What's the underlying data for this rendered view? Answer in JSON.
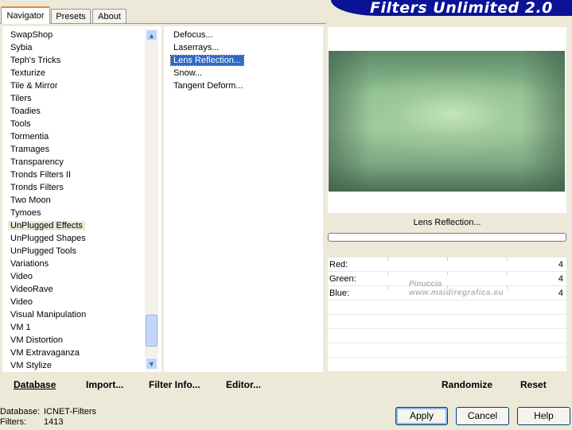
{
  "tabs": [
    {
      "label": "Navigator",
      "active": true
    },
    {
      "label": "Presets",
      "active": false
    },
    {
      "label": "About",
      "active": false
    }
  ],
  "banner": {
    "title": "Filters Unlimited 2.0",
    "color": "#0a1296"
  },
  "categories": [
    "SwapShop",
    "Sybia",
    "Teph's Tricks",
    "Texturize",
    "Tile & Mirror",
    "Tilers",
    "Toadies",
    "Tools",
    "Tormentia",
    "Tramages",
    "Transparency",
    "Tronds Filters II",
    "Tronds Filters",
    "Two Moon",
    "Tymoes",
    "UnPlugged Effects",
    "UnPlugged Shapes",
    "UnPlugged Tools",
    "Variations",
    "Video",
    "VideoRave",
    "Video",
    "Visual Manipulation",
    "VM 1",
    "VM Distortion",
    "VM Extravaganza",
    "VM Stylize"
  ],
  "selected_category": "UnPlugged Effects",
  "filters": [
    "Defocus...",
    "Laserrays...",
    "Lens Reflection...",
    "Snow...",
    "Tangent Deform..."
  ],
  "selected_filter": "Lens Reflection...",
  "toolbar": {
    "database": "Database",
    "import": "Import...",
    "filter_info": "Filter Info...",
    "editor": "Editor...",
    "randomize": "Randomize",
    "reset": "Reset"
  },
  "preview": {
    "filter_name": "Lens Reflection..."
  },
  "params": [
    {
      "label": "Red:",
      "value": "4"
    },
    {
      "label": "Green:",
      "value": "4"
    },
    {
      "label": "Blue:",
      "value": "4"
    }
  ],
  "watermark": {
    "line1": "Pinuccia",
    "line2": "www.maidiregrafica.eu"
  },
  "status": {
    "database_label": "Database:",
    "database_value": "ICNET-Filters",
    "filters_label": "Filters:",
    "filters_value": "1413"
  },
  "buttons": {
    "apply": "Apply",
    "cancel": "Cancel",
    "help": "Help"
  },
  "colors": {
    "selection": "#316ac5",
    "tab_accent": "#e68b2c",
    "dialog_bg": "#ece9d8"
  }
}
